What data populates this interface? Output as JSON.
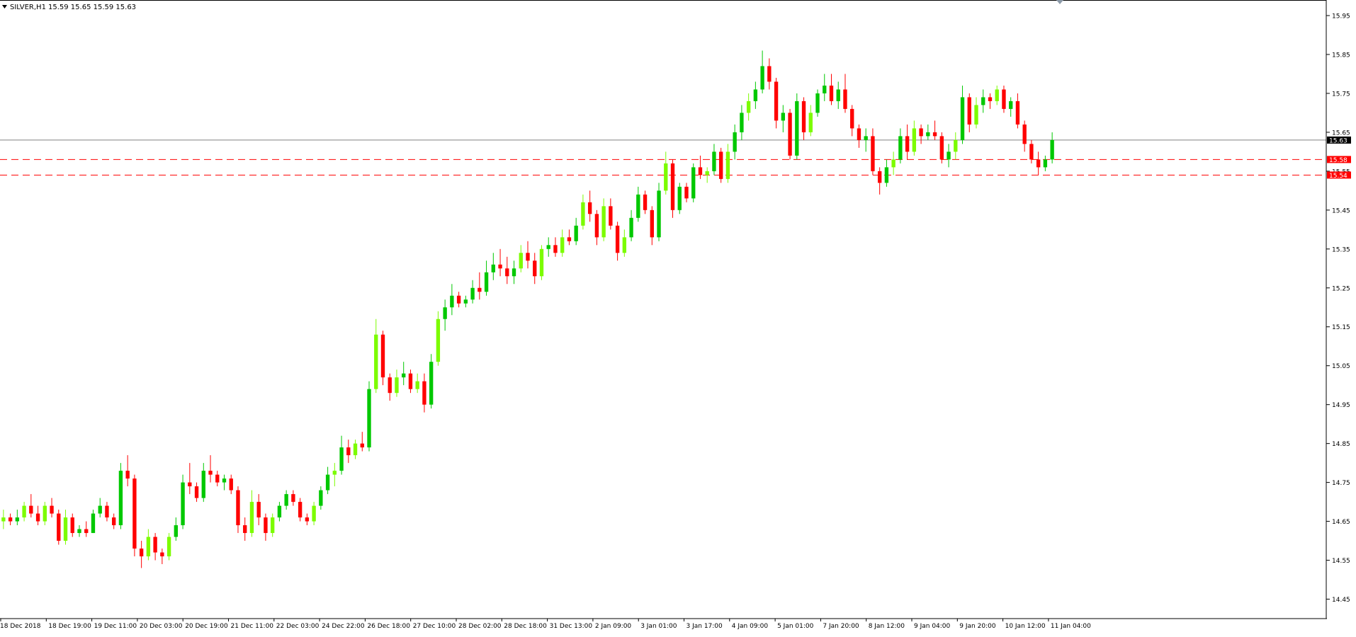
{
  "header": {
    "arrow_icon": "triangle-down-icon",
    "symbol_timeframe": "SILVER,H1",
    "ohlc": "15.59 15.65 15.59 15.63"
  },
  "colors": {
    "background": "#ffffff",
    "frame": "#000000",
    "bull_candle": "#00c800",
    "bull_candle_light": "#7cfc00",
    "bear_candle": "#ff0000",
    "current_price_line": "#808080",
    "level_line": "#ff0000"
  },
  "chart_data": {
    "type": "candlestick",
    "title": "",
    "xlabel": "",
    "ylabel": "",
    "ylim": [
      14.4,
      15.99
    ],
    "grid": false,
    "price_ticks": [
      "15.95",
      "15.85",
      "15.75",
      "15.65",
      "15.55",
      "15.45",
      "15.35",
      "15.25",
      "15.15",
      "15.05",
      "14.95",
      "14.85",
      "14.75",
      "14.65",
      "14.55",
      "14.45"
    ],
    "time_labels": [
      "18 Dec 2018",
      "18 Dec 19:00",
      "19 Dec 11:00",
      "20 Dec 03:00",
      "20 Dec 19:00",
      "21 Dec 11:00",
      "22 Dec 03:00",
      "24 Dec 22:00",
      "26 Dec 18:00",
      "27 Dec 10:00",
      "28 Dec 02:00",
      "28 Dec 18:00",
      "31 Dec 13:00",
      "2 Jan 09:00",
      "3 Jan 01:00",
      "3 Jan 17:00",
      "4 Jan 09:00",
      "5 Jan 01:00",
      "7 Jan 20:00",
      "8 Jan 12:00",
      "9 Jan 04:00",
      "9 Jan 20:00",
      "10 Jan 12:00",
      "11 Jan 04:00"
    ],
    "current_price": {
      "value": 15.63,
      "label": "15.63"
    },
    "levels": [
      {
        "value": 15.58,
        "label": "15.58",
        "style": "dashed"
      },
      {
        "value": 15.54,
        "label": "15.54",
        "style": "dashed"
      }
    ],
    "candles": [
      [
        14.65,
        14.68,
        14.63,
        14.66
      ],
      [
        14.66,
        14.67,
        14.64,
        14.65
      ],
      [
        14.65,
        14.68,
        14.64,
        14.66
      ],
      [
        14.66,
        14.7,
        14.65,
        14.69
      ],
      [
        14.69,
        14.72,
        14.66,
        14.67
      ],
      [
        14.67,
        14.69,
        14.64,
        14.65
      ],
      [
        14.65,
        14.7,
        14.64,
        14.69
      ],
      [
        14.69,
        14.71,
        14.66,
        14.67
      ],
      [
        14.67,
        14.68,
        14.59,
        14.6
      ],
      [
        14.6,
        14.68,
        14.59,
        14.66
      ],
      [
        14.66,
        14.67,
        14.61,
        14.62
      ],
      [
        14.62,
        14.64,
        14.61,
        14.63
      ],
      [
        14.63,
        14.65,
        14.61,
        14.62
      ],
      [
        14.62,
        14.68,
        14.62,
        14.67
      ],
      [
        14.67,
        14.71,
        14.66,
        14.69
      ],
      [
        14.69,
        14.7,
        14.65,
        14.66
      ],
      [
        14.66,
        14.67,
        14.63,
        14.64
      ],
      [
        14.64,
        14.8,
        14.63,
        14.78
      ],
      [
        14.78,
        14.82,
        14.74,
        14.76
      ],
      [
        14.76,
        14.77,
        14.56,
        14.58
      ],
      [
        14.58,
        14.6,
        14.53,
        14.56
      ],
      [
        14.56,
        14.63,
        14.55,
        14.61
      ],
      [
        14.61,
        14.62,
        14.55,
        14.57
      ],
      [
        14.57,
        14.58,
        14.54,
        14.56
      ],
      [
        14.56,
        14.62,
        14.55,
        14.61
      ],
      [
        14.61,
        14.66,
        14.6,
        14.64
      ],
      [
        14.64,
        14.77,
        14.63,
        14.75
      ],
      [
        14.75,
        14.8,
        14.72,
        14.74
      ],
      [
        14.74,
        14.75,
        14.7,
        14.71
      ],
      [
        14.71,
        14.8,
        14.7,
        14.78
      ],
      [
        14.78,
        14.82,
        14.75,
        14.77
      ],
      [
        14.77,
        14.78,
        14.74,
        14.75
      ],
      [
        14.75,
        14.77,
        14.73,
        14.76
      ],
      [
        14.76,
        14.77,
        14.72,
        14.73
      ],
      [
        14.73,
        14.74,
        14.62,
        14.64
      ],
      [
        14.64,
        14.66,
        14.6,
        14.62
      ],
      [
        14.62,
        14.73,
        14.61,
        14.7
      ],
      [
        14.7,
        14.72,
        14.64,
        14.66
      ],
      [
        14.66,
        14.67,
        14.6,
        14.62
      ],
      [
        14.62,
        14.67,
        14.61,
        14.66
      ],
      [
        14.66,
        14.7,
        14.65,
        14.69
      ],
      [
        14.69,
        14.73,
        14.68,
        14.72
      ],
      [
        14.72,
        14.73,
        14.69,
        14.7
      ],
      [
        14.7,
        14.71,
        14.65,
        14.66
      ],
      [
        14.66,
        14.67,
        14.64,
        14.65
      ],
      [
        14.65,
        14.7,
        14.64,
        14.69
      ],
      [
        14.69,
        14.74,
        14.68,
        14.73
      ],
      [
        14.73,
        14.79,
        14.72,
        14.77
      ],
      [
        14.77,
        14.8,
        14.74,
        14.78
      ],
      [
        14.78,
        14.87,
        14.77,
        14.84
      ],
      [
        14.84,
        14.86,
        14.8,
        14.82
      ],
      [
        14.82,
        14.86,
        14.81,
        14.85
      ],
      [
        14.85,
        14.88,
        14.83,
        14.84
      ],
      [
        14.84,
        15.01,
        14.83,
        14.99
      ],
      [
        14.99,
        15.17,
        14.98,
        15.13
      ],
      [
        15.13,
        15.14,
        15.0,
        15.02
      ],
      [
        15.02,
        15.03,
        14.96,
        14.98
      ],
      [
        14.98,
        15.04,
        14.97,
        15.02
      ],
      [
        15.02,
        15.06,
        15.0,
        15.03
      ],
      [
        15.03,
        15.04,
        14.98,
        14.99
      ],
      [
        14.99,
        15.03,
        14.98,
        15.01
      ],
      [
        15.01,
        15.03,
        14.93,
        14.95
      ],
      [
        14.95,
        15.08,
        14.94,
        15.06
      ],
      [
        15.06,
        15.19,
        15.05,
        15.17
      ],
      [
        15.17,
        15.22,
        15.14,
        15.2
      ],
      [
        15.2,
        15.26,
        15.18,
        15.23
      ],
      [
        15.23,
        15.24,
        15.2,
        15.21
      ],
      [
        15.21,
        15.23,
        15.2,
        15.22
      ],
      [
        15.22,
        15.27,
        15.21,
        15.25
      ],
      [
        15.25,
        15.29,
        15.22,
        15.24
      ],
      [
        15.24,
        15.32,
        15.23,
        15.29
      ],
      [
        15.29,
        15.34,
        15.27,
        15.31
      ],
      [
        15.31,
        15.35,
        15.28,
        15.3
      ],
      [
        15.3,
        15.33,
        15.26,
        15.28
      ],
      [
        15.28,
        15.32,
        15.26,
        15.3
      ],
      [
        15.3,
        15.36,
        15.29,
        15.34
      ],
      [
        15.34,
        15.37,
        15.3,
        15.32
      ],
      [
        15.32,
        15.34,
        15.26,
        15.28
      ],
      [
        15.28,
        15.36,
        15.27,
        15.35
      ],
      [
        15.35,
        15.38,
        15.33,
        15.36
      ],
      [
        15.36,
        15.38,
        15.33,
        15.34
      ],
      [
        15.34,
        15.4,
        15.33,
        15.38
      ],
      [
        15.38,
        15.4,
        15.36,
        15.37
      ],
      [
        15.37,
        15.43,
        15.36,
        15.41
      ],
      [
        15.41,
        15.49,
        15.4,
        15.47
      ],
      [
        15.47,
        15.5,
        15.42,
        15.44
      ],
      [
        15.44,
        15.45,
        15.36,
        15.38
      ],
      [
        15.38,
        15.48,
        15.37,
        15.46
      ],
      [
        15.46,
        15.48,
        15.4,
        15.41
      ],
      [
        15.41,
        15.42,
        15.32,
        15.34
      ],
      [
        15.34,
        15.4,
        15.33,
        15.38
      ],
      [
        15.38,
        15.45,
        15.37,
        15.43
      ],
      [
        15.43,
        15.51,
        15.42,
        15.49
      ],
      [
        15.49,
        15.5,
        15.44,
        15.45
      ],
      [
        15.45,
        15.46,
        15.36,
        15.38
      ],
      [
        15.38,
        15.52,
        15.37,
        15.5
      ],
      [
        15.5,
        15.6,
        15.49,
        15.57
      ],
      [
        15.57,
        15.58,
        15.43,
        15.45
      ],
      [
        15.45,
        15.52,
        15.44,
        15.51
      ],
      [
        15.51,
        15.52,
        15.47,
        15.48
      ],
      [
        15.48,
        15.57,
        15.47,
        15.56
      ],
      [
        15.56,
        15.59,
        15.53,
        15.54
      ],
      [
        15.54,
        15.56,
        15.52,
        15.55
      ],
      [
        15.55,
        15.62,
        15.54,
        15.6
      ],
      [
        15.6,
        15.61,
        15.52,
        15.53
      ],
      [
        15.53,
        15.62,
        15.52,
        15.6
      ],
      [
        15.6,
        15.67,
        15.58,
        15.65
      ],
      [
        15.65,
        15.72,
        15.63,
        15.7
      ],
      [
        15.7,
        15.75,
        15.68,
        15.73
      ],
      [
        15.73,
        15.78,
        15.71,
        15.76
      ],
      [
        15.76,
        15.86,
        15.75,
        15.82
      ],
      [
        15.82,
        15.84,
        15.76,
        15.78
      ],
      [
        15.78,
        15.79,
        15.66,
        15.68
      ],
      [
        15.68,
        15.72,
        15.65,
        15.7
      ],
      [
        15.7,
        15.71,
        15.58,
        15.59
      ],
      [
        15.59,
        15.75,
        15.58,
        15.73
      ],
      [
        15.73,
        15.74,
        15.63,
        15.65
      ],
      [
        15.65,
        15.72,
        15.64,
        15.7
      ],
      [
        15.7,
        15.76,
        15.69,
        15.75
      ],
      [
        15.75,
        15.8,
        15.73,
        15.77
      ],
      [
        15.77,
        15.8,
        15.72,
        15.73
      ],
      [
        15.73,
        15.78,
        15.71,
        15.76
      ],
      [
        15.76,
        15.8,
        15.7,
        15.71
      ],
      [
        15.71,
        15.72,
        15.64,
        15.66
      ],
      [
        15.66,
        15.67,
        15.61,
        15.63
      ],
      [
        15.63,
        15.66,
        15.6,
        15.64
      ],
      [
        15.64,
        15.66,
        15.54,
        15.55
      ],
      [
        15.55,
        15.56,
        15.49,
        15.52
      ],
      [
        15.52,
        15.58,
        15.51,
        15.56
      ],
      [
        15.56,
        15.6,
        15.54,
        15.58
      ],
      [
        15.58,
        15.66,
        15.57,
        15.64
      ],
      [
        15.64,
        15.67,
        15.58,
        15.6
      ],
      [
        15.6,
        15.68,
        15.59,
        15.66
      ],
      [
        15.66,
        15.67,
        15.62,
        15.64
      ],
      [
        15.64,
        15.67,
        15.63,
        15.65
      ],
      [
        15.65,
        15.68,
        15.63,
        15.64
      ],
      [
        15.64,
        15.65,
        15.57,
        15.58
      ],
      [
        15.58,
        15.62,
        15.56,
        15.6
      ],
      [
        15.6,
        15.65,
        15.58,
        15.63
      ],
      [
        15.63,
        15.77,
        15.62,
        15.74
      ],
      [
        15.74,
        15.75,
        15.65,
        15.67
      ],
      [
        15.67,
        15.74,
        15.66,
        15.72
      ],
      [
        15.72,
        15.76,
        15.7,
        15.74
      ],
      [
        15.74,
        15.75,
        15.71,
        15.73
      ],
      [
        15.73,
        15.77,
        15.72,
        15.76
      ],
      [
        15.76,
        15.77,
        15.7,
        15.71
      ],
      [
        15.71,
        15.74,
        15.69,
        15.73
      ],
      [
        15.73,
        15.75,
        15.66,
        15.67
      ],
      [
        15.67,
        15.68,
        15.6,
        15.62
      ],
      [
        15.62,
        15.63,
        15.57,
        15.58
      ],
      [
        15.58,
        15.6,
        15.54,
        15.56
      ],
      [
        15.56,
        15.59,
        15.55,
        15.58
      ],
      [
        15.58,
        15.65,
        15.57,
        15.63
      ]
    ]
  }
}
